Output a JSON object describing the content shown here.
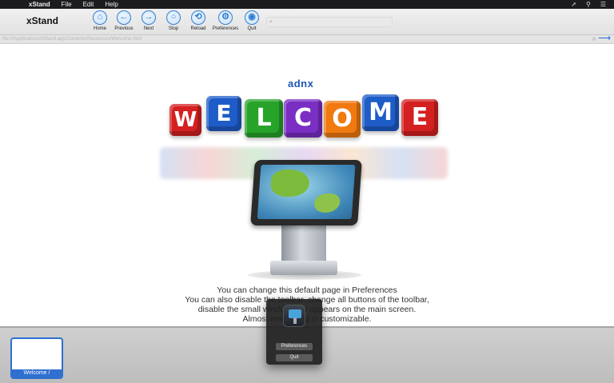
{
  "menubar": {
    "apple_icon": "apple-icon",
    "items": [
      "xStand",
      "File",
      "Edit",
      "Help"
    ],
    "right_icons": [
      "cursor-icon",
      "search-icon",
      "menu-list-icon"
    ]
  },
  "toolbar": {
    "app_title": "xStand",
    "buttons": [
      {
        "label": "Home",
        "icon": "globe-icon",
        "glyph": "⌂"
      },
      {
        "label": "Previous",
        "icon": "arrow-left-icon",
        "glyph": "←"
      },
      {
        "label": "Next",
        "icon": "arrow-right-icon",
        "glyph": "→"
      },
      {
        "label": "Stop",
        "icon": "stop-icon",
        "glyph": "○"
      },
      {
        "label": "Reload",
        "icon": "reload-icon",
        "glyph": "⟲"
      },
      {
        "label": "Preferences",
        "icon": "gear-icon",
        "glyph": "⚙"
      },
      {
        "label": "Quit",
        "icon": "globe-quit-icon",
        "glyph": "◉"
      }
    ],
    "search_placeholder": "⌕"
  },
  "address": {
    "url": "file:///Applications/xStand.app/Contents/Resources/Welcome.html",
    "go_icon": "arrow-go-icon",
    "clear_icon": "clear-icon"
  },
  "content": {
    "logo": "adnx",
    "welcome_letters": [
      "W",
      "E",
      "L",
      "C",
      "O",
      "M",
      "E"
    ],
    "welcome_colors": [
      "#d42020",
      "#1e5cc8",
      "#27a32a",
      "#7a2ec4",
      "#f07a10",
      "#1e5cc8",
      "#d42020"
    ],
    "lines": [
      "You can change this default page in Preferences",
      "You can also disable the toolbar, change all buttons of the toolbar,",
      "disable the small window that appears on the main screen.",
      "Almost everything is customizable."
    ]
  },
  "tabs": [
    {
      "label": "Welcome /"
    }
  ],
  "popup": {
    "preferences_label": "Preferences",
    "quit_label": "Quit"
  }
}
